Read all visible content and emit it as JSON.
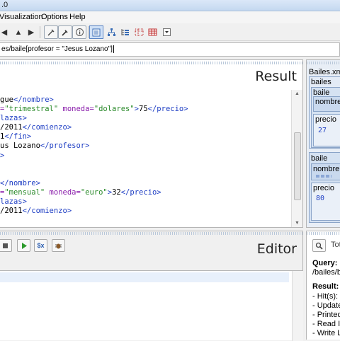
{
  "window": {
    "title_fragment": ".0"
  },
  "menu": [
    "Visualization",
    "Options",
    "Help"
  ],
  "query": {
    "value": "es/baile[profesor = \"Jesus Lozano\"]"
  },
  "result": {
    "title": "Result",
    "lines": [
      [
        {
          "c": "txt",
          "t": "gue"
        },
        {
          "c": "tag",
          "t": "</nombre>"
        }
      ],
      [
        {
          "c": "attr",
          "t": "="
        },
        {
          "c": "str",
          "t": "\"trimestral\""
        },
        {
          "c": "attr",
          "t": " moneda="
        },
        {
          "c": "str",
          "t": "\"dolares\""
        },
        {
          "c": "tag",
          "t": ">"
        },
        {
          "c": "txt",
          "t": "75"
        },
        {
          "c": "tag",
          "t": "</precio>"
        }
      ],
      [
        {
          "c": "tag",
          "t": "lazas>"
        }
      ],
      [
        {
          "c": "txt",
          "t": "/2011"
        },
        {
          "c": "tag",
          "t": "</comienzo>"
        }
      ],
      [
        {
          "c": "txt",
          "t": "1"
        },
        {
          "c": "tag",
          "t": "</fin>"
        }
      ],
      [
        {
          "c": "txt",
          "t": "us Lozano"
        },
        {
          "c": "tag",
          "t": "</profesor>"
        }
      ],
      [
        {
          "c": "tag",
          "t": ">"
        }
      ],
      [
        {
          "c": "txt",
          "t": ""
        }
      ],
      [
        {
          "c": "txt",
          "t": ""
        }
      ],
      [
        {
          "c": "tag",
          "t": "</nombre>"
        }
      ],
      [
        {
          "c": "attr",
          "t": "="
        },
        {
          "c": "str",
          "t": "\"mensual\""
        },
        {
          "c": "attr",
          "t": " moneda="
        },
        {
          "c": "str",
          "t": "\"euro\""
        },
        {
          "c": "tag",
          "t": ">"
        },
        {
          "c": "txt",
          "t": "32"
        },
        {
          "c": "tag",
          "t": "</precio>"
        }
      ],
      [
        {
          "c": "tag",
          "t": "lazas>"
        }
      ],
      [
        {
          "c": "txt",
          "t": "/2011"
        },
        {
          "c": "tag",
          "t": "</comienzo>"
        }
      ]
    ]
  },
  "map": {
    "title": "Bailes.xm",
    "root": "bailes",
    "baile1": {
      "label": "baile",
      "nombre": "nombre",
      "precio": "precio",
      "precio_val": "27"
    },
    "baile2": {
      "label": "baile",
      "nombre": "nombre",
      "precio": "precio",
      "precio_val": "80"
    }
  },
  "editor": {
    "title": "Editor"
  },
  "info": {
    "tab_label": "Tot",
    "query_heading": "Query:",
    "query_text": "/bailes/b",
    "result_heading": "Result:",
    "items": [
      "- Hit(s):",
      "- Update",
      "- Printed",
      "- Read I",
      "- Write L"
    ]
  }
}
